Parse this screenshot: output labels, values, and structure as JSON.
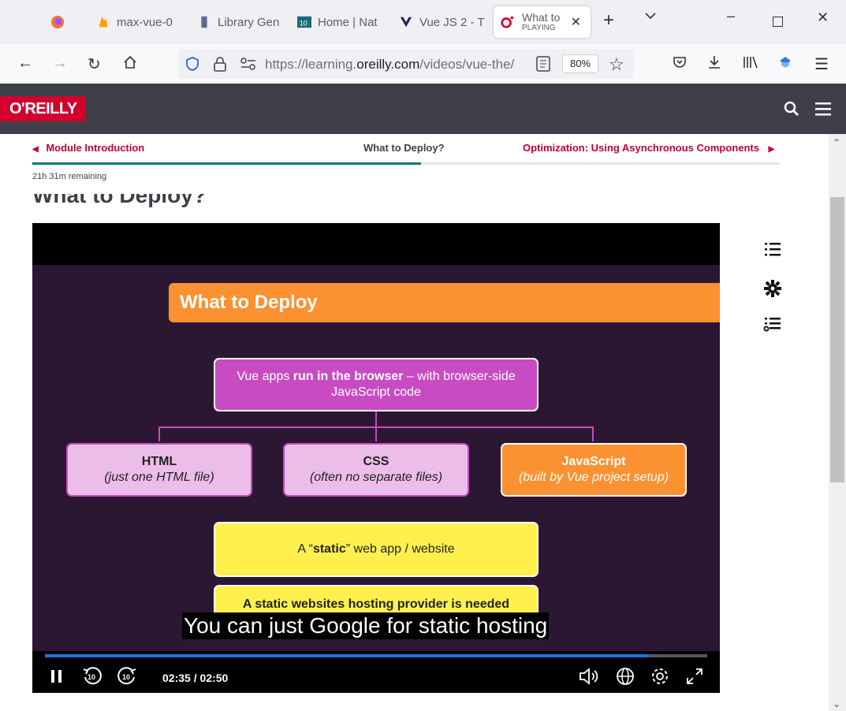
{
  "browser": {
    "tabs": [
      {
        "label": "",
        "icon": "firefox-icon"
      },
      {
        "label": "max-vue-0",
        "icon": "firebase-icon"
      },
      {
        "label": "Library Gen",
        "icon": "library-icon"
      },
      {
        "label": "Home | Nat",
        "icon": "s10-icon"
      },
      {
        "label": "Vue JS 2 - T",
        "icon": "vue-icon"
      }
    ],
    "active_tab": {
      "title": "What to",
      "status": "PLAYING"
    },
    "url_prefix": "https://learning.",
    "url_domain": "oreilly.com",
    "url_suffix": "/videos/vue-the/",
    "zoom": "80%"
  },
  "page": {
    "logo": "O'REILLY",
    "prev_module": "Module Introduction",
    "current_module": "What to Deploy?",
    "next_module": "Optimization: Using Asynchronous Components",
    "remaining": "21h 31m remaining",
    "progress_fraction": 0.52,
    "heading": "What to Deploy?"
  },
  "video": {
    "slide_title": "What to Deploy",
    "main_box_a": "Vue apps ",
    "main_box_b": "run in the browser",
    "main_box_c": " – with browser-side",
    "main_box_d": "JavaScript code",
    "html_title": "HTML",
    "html_sub": "(just one HTML file)",
    "css_title": "CSS",
    "css_sub": "(often no separate files)",
    "js_title": "JavaScript",
    "js_sub": "(built by Vue project setup)",
    "static_a": "A “",
    "static_b": "static",
    "static_c": "” web app / website",
    "host_text": "A static websites hosting provider is needed",
    "subtitle": "You can just Google for static hosting",
    "time": "02:35 / 02:50",
    "progress_fraction": 0.912,
    "rewind_label": "10",
    "forward_label": "10"
  },
  "colors": {
    "brand_red": "#d3002d",
    "header_bg": "#3e3f48",
    "slide_bg": "#2c1733",
    "accent_orange": "#fb9131",
    "accent_purple": "#c94bc3",
    "accent_yellow": "#fff04e"
  }
}
